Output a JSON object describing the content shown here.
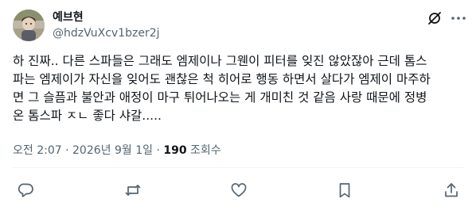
{
  "author": {
    "name": "예브현",
    "handle": "@hdzVuXcv1bzer2j"
  },
  "tweet": {
    "lines": [
      "하 진짜.. 다른 스파들은 그래도 엠제이나 그웬이 피터를 잊진 않았잖아 근데 톰스",
      "파는 엠제이가 자신을 잊어도 괜찮은 척 히어로 행동 하면서 살다가 엠제이 마주하",
      "면 그 슬픔과 불안과 애정이 마구 튀어나오는 게 개미친 것 같음 사랑 때문에 정병",
      "온 톰스파 ㅈㄴ 좋다 샤갈....."
    ]
  },
  "meta": {
    "time": "오전 2:07",
    "separator": " · ",
    "date": "2026년 9월 1일",
    "views_count": "190",
    "views_label": " 조회수"
  },
  "icons": {
    "header": [
      "grok-icon",
      "more-icon"
    ],
    "actions": [
      "reply-icon",
      "repost-icon",
      "like-icon",
      "bookmark-icon",
      "share-icon"
    ],
    "icon_color": "#536471"
  },
  "colors": {
    "text": "#0f1419",
    "secondary": "#536471",
    "divider": "#eff3f4"
  }
}
